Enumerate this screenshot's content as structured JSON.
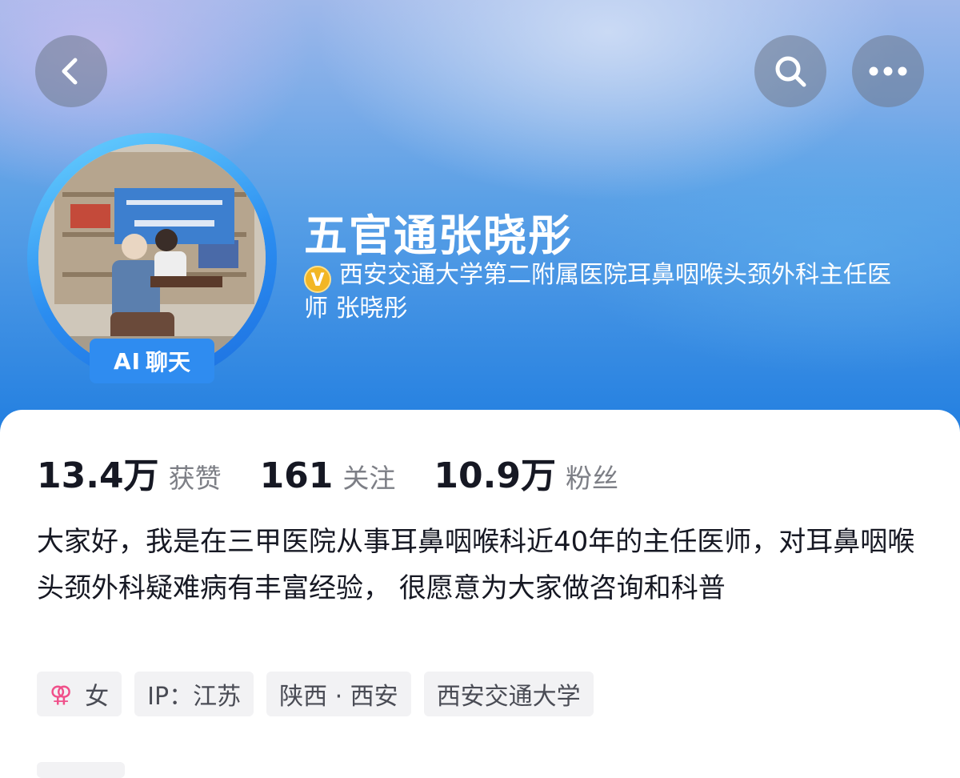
{
  "header": {
    "back_icon": "chevron-left-icon",
    "search_icon": "search-icon",
    "more_icon": "more-dots-icon",
    "gradient_colors": [
      "#9fb8ea",
      "#5aa0e6",
      "#1f7de0"
    ]
  },
  "profile": {
    "ai_badge": {
      "ai": "AI",
      "label": "聊天"
    },
    "name": "五官通张晓彤",
    "verification_icon": "verified-v-icon",
    "verification_color": "#f2b625",
    "verification_text": "西安交通大学第二附属医院耳鼻咽喉头颈外科主任医师 张晓彤"
  },
  "stats": [
    {
      "value": "13.4万",
      "label": "获赞"
    },
    {
      "value": "161",
      "label": "关注"
    },
    {
      "value": "10.9万",
      "label": "粉丝"
    }
  ],
  "bio": "大家好，我是在三甲医院从事耳鼻咽喉科近40年的主任医师，对耳鼻咽喉头颈外科疑难病有丰富经验， 很愿意为大家做咨询和科普",
  "tags": [
    {
      "icon": "female-icon",
      "icon_glyph": "⚢",
      "text": "女"
    },
    {
      "text": "IP：江苏"
    },
    {
      "text": "陕西 · 西安"
    },
    {
      "text": "西安交通大学"
    }
  ],
  "colors": {
    "accent": "#2f8cf0",
    "text_primary": "#161823",
    "text_secondary": "#7d7f86",
    "gender": "#f0508a"
  }
}
